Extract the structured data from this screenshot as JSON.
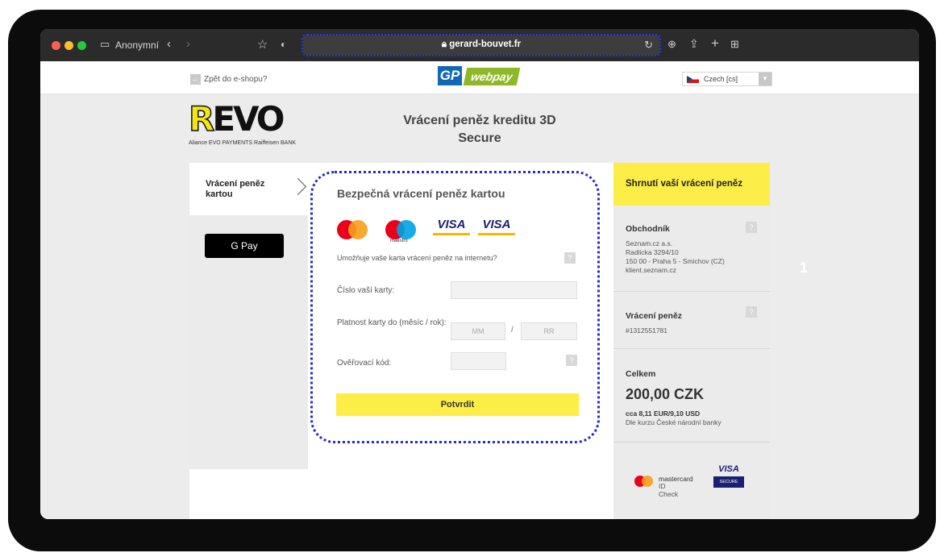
{
  "browser": {
    "profile_label": "Anonymní",
    "url": "gerard-bouvet.fr"
  },
  "gateway": {
    "back_link": "Zpět do e-shopu?",
    "logo_left": "GP",
    "logo_right": "webpay",
    "language": "Czech [cs]"
  },
  "merchant_logo": {
    "wordmark_prefix": "R",
    "wordmark_rest": "EVO",
    "sub": "Aliance EVO PAYMENTS Raiffeisen BANK"
  },
  "page_title_line1": "Vrácení peněz kreditu 3D",
  "page_title_line2": "Secure",
  "steps": {
    "current_step": "Vrácení peněz kartou",
    "gpay_label": "G Pay"
  },
  "form": {
    "heading": "Bezpečná vrácení peněz kartou",
    "cards": [
      "mastercard",
      "maestro",
      "VISA",
      "VISA"
    ],
    "maestro_label": "maestro",
    "visa_label": "VISA",
    "visa_electron_label": "VISA",
    "hint": "Umožňuje vaše karta vrácení peněz na internetu?",
    "card_number_label": "Číslo vaší karty:",
    "expiry_label": "Platnost karty do (měsíc / rok):",
    "expiry_month_placeholder": "MM",
    "expiry_separator": "/",
    "expiry_year_placeholder": "RR",
    "cvc_label": "Ověřovací kód:",
    "help_mark": "?",
    "submit_label": "Potvrdit"
  },
  "summary": {
    "heading": "Shrnutí vaší vrácení peněz",
    "merchant_heading": "Obchodník",
    "merchant_lines": [
      "Seznam.cz a.s.",
      "Radlicka 3294/10",
      "150 00 - Praha 5 - Smichov (CZ)",
      "klient.seznam.cz"
    ],
    "refund_heading": "Vrácení peněz",
    "refund_id": "#1312551781",
    "total_heading": "Celkem",
    "total_amount": "200,00 CZK",
    "fx_line": "cca 8,11 EUR/9,10 USD",
    "fx_note": "Dle kurzu České národní banky",
    "mc_idcheck_line1": "mastercard",
    "mc_idcheck_line2": "ID Check",
    "visa_secure_top": "VISA",
    "visa_secure_bottom": "SECURE"
  },
  "overlay_marker": "1",
  "colors": {
    "accent_yellow": "#fcee47",
    "gp_blue": "#1268b3",
    "webpay_green": "#8fb829",
    "focus_dotted": "#2a2ccb"
  }
}
